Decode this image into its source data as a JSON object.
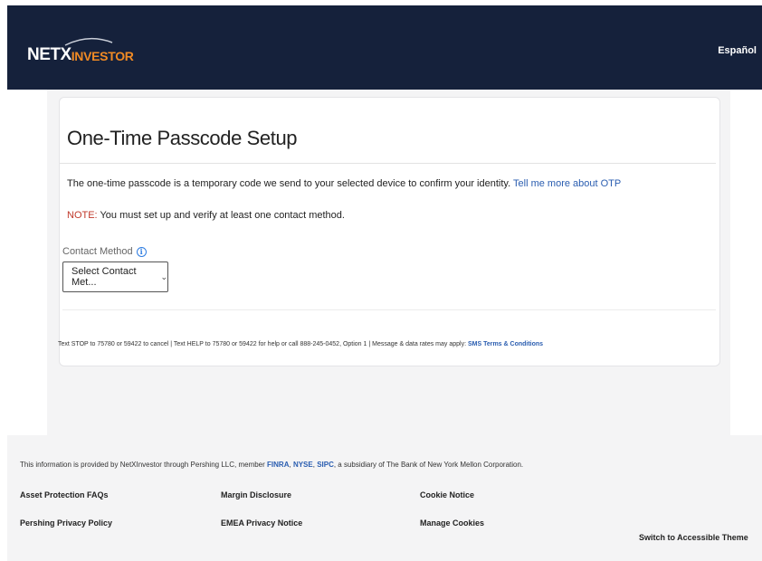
{
  "header": {
    "logo_primary": "NETX",
    "logo_secondary": "INVESTOR",
    "language_link": "Español"
  },
  "card": {
    "title": "One-Time Passcode Setup",
    "description": "The one-time passcode is a temporary code we send to your selected device to confirm your identity.",
    "description_link": "Tell me more about OTP",
    "note_label": "NOTE:",
    "note_text": "You must set up and verify at least one contact method.",
    "contact_method_label": "Contact Method",
    "contact_method_select": "Select Contact Met...",
    "sms_text": "Text STOP to 75780 or 59422 to cancel | Text HELP to 75780 or 59422 for help or call 888-245-0452, Option 1 | Message & data rates may apply:",
    "sms_link": "SMS Terms & Conditions"
  },
  "footer": {
    "info_prefix": "This information is provided by NetXInvestor through Pershing LLC, member",
    "info_finra": "FINRA",
    "info_nyse": "NYSE",
    "info_sipc": "SIPC",
    "info_suffix": ", a subsidiary of The Bank of New York Mellon Corporation.",
    "links": {
      "asset_protection": "Asset Protection FAQs",
      "margin_disclosure": "Margin Disclosure",
      "cookie_notice": "Cookie Notice",
      "pershing_privacy": "Pershing Privacy Policy",
      "emea_privacy": "EMEA Privacy Notice",
      "manage_cookies": "Manage Cookies",
      "accessible_theme": "Switch to Accessible Theme"
    }
  },
  "colors": {
    "header_bg": "#15213b",
    "logo_accent": "#f08a24",
    "link": "#2a5db0",
    "note": "#c0392b"
  }
}
